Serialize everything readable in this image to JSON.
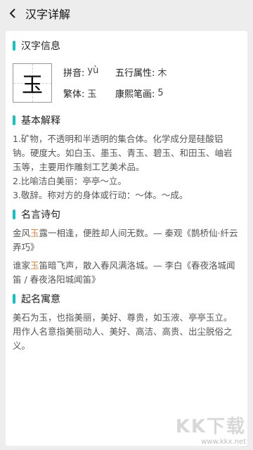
{
  "header": {
    "title": "汉字详解",
    "back_icon": "chevron-left-icon"
  },
  "info": {
    "section_title": "汉字信息",
    "character": "玉",
    "pinyin_label": "拼音:",
    "pinyin": "yù",
    "wuxing_label": "五行属性:",
    "wuxing": "木",
    "traditional_label": "繁体:",
    "traditional": "玉",
    "strokes_label": "康熙笔画:",
    "strokes": "5"
  },
  "basic": {
    "section_title": "基本解释",
    "lines": [
      "1.矿物，不透明和半透明的集合体。化学成分是硅酸铝钠。硬度大。如白玉、墨玉、青玉、碧玉、和田玉、岫岩玉等，主要用作雕刻工艺美术品。",
      "2.比喻洁白美丽：亭亭～立。",
      "3.敬辞。称对方的身体或行动：～体。～成。"
    ]
  },
  "quotes": {
    "section_title": "名言诗句",
    "items": [
      {
        "pre": "金风",
        "hl": "玉",
        "post": "露一相逢，便胜却人间无数。— 秦观《鹊桥仙·纤云弄巧》"
      },
      {
        "pre": "谁家",
        "hl": "玉",
        "post": "笛暗飞声，散入春风满洛城。— 李白《春夜洛城闻笛 / 春夜洛阳城闻笛》"
      }
    ]
  },
  "naming": {
    "section_title": "起名寓意",
    "text": "美石为玉，也指美丽，美好、尊贵，如玉液、亭亭玉立。用作人名意指美丽动人、美好、高洁、高贵、出尘脱俗之义。"
  },
  "watermark": {
    "text": "KK下载",
    "url": "www.kkx.net"
  },
  "colors": {
    "accent": "#16c1bf",
    "highlight": "#d9823c"
  }
}
